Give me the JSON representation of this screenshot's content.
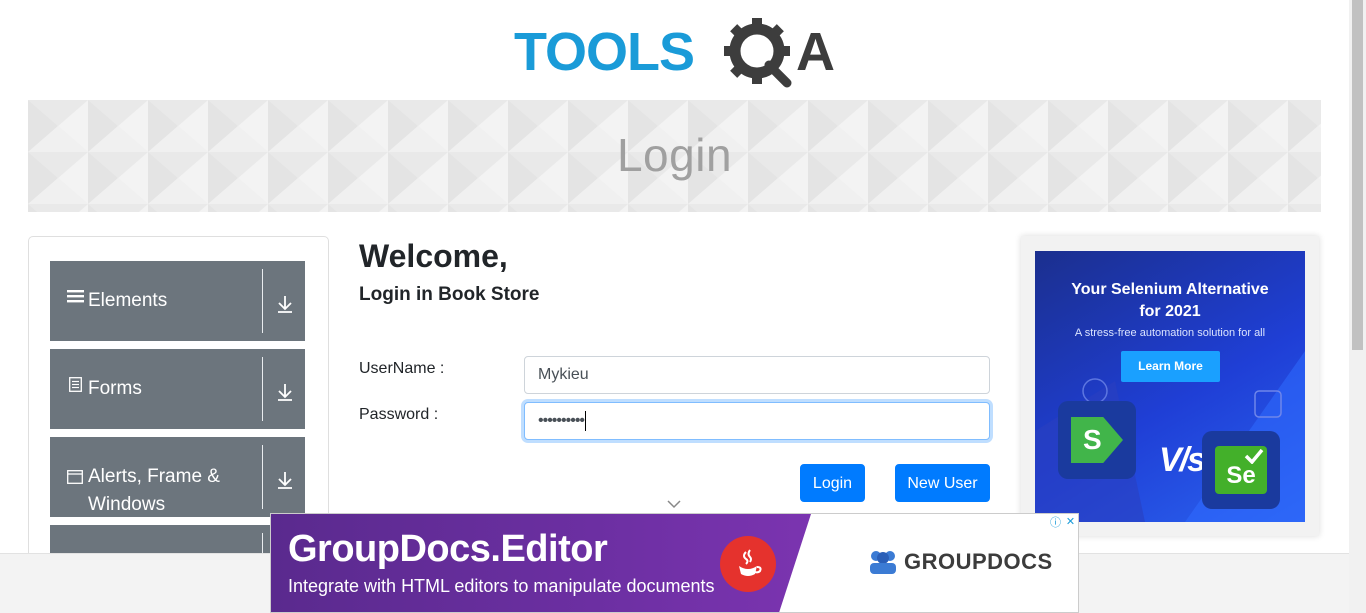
{
  "brand": {
    "logo_text": "TOOLSQA",
    "logo_main": "TOOLS",
    "logo_tail": "A"
  },
  "banner": {
    "title": "Login"
  },
  "sidebar": {
    "groups": [
      {
        "label": "Elements",
        "icon": "menu-icon"
      },
      {
        "label": "Forms",
        "icon": "document-icon"
      },
      {
        "label": "Alerts, Frame & Windows",
        "label_line1": "Alerts, Frame &",
        "label_line2": "Windows",
        "icon": "window-icon"
      },
      {
        "label": "",
        "icon": ""
      }
    ]
  },
  "login": {
    "welcome": "Welcome,",
    "subtitle": "Login in Book Store",
    "username_label": "UserName :",
    "username_value": "Mykieu",
    "password_label": "Password :",
    "password_value": "••••••••••",
    "login_button": "Login",
    "new_user_button": "New User"
  },
  "right_ad": {
    "heading_line1": "Your Selenium Alternative",
    "heading_line2": "for 2021",
    "subtext": "A stress-free automation solution for all",
    "cta": "Learn More",
    "vs_text": "V/s",
    "left_logo": "S",
    "right_logo": "Se"
  },
  "bottom_ad": {
    "title": "GroupDocs.Editor",
    "subtitle": "Integrate with HTML editors to manipulate documents",
    "brand": "GROUPDOCS"
  },
  "colors": {
    "primary": "#007bff",
    "sidebar_group": "#6c757d",
    "logo_blue": "#1a9bd8",
    "logo_dark": "#3d3d3d"
  }
}
